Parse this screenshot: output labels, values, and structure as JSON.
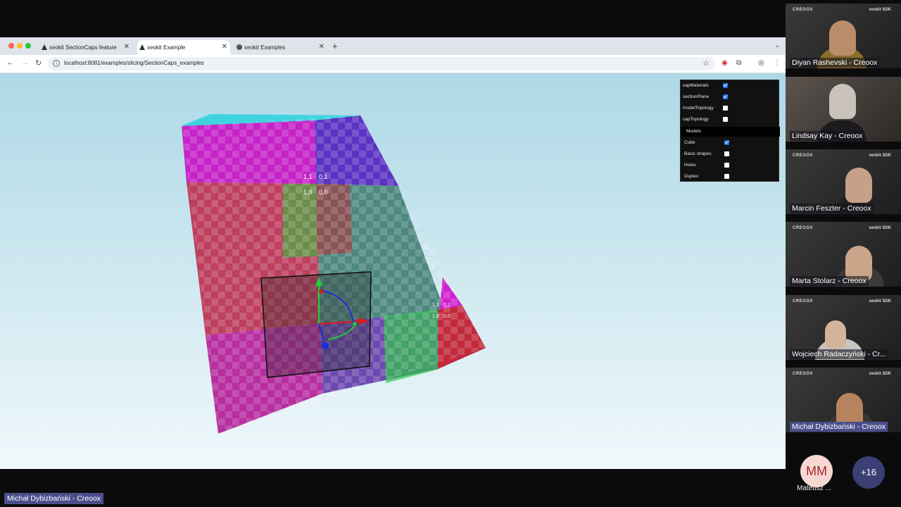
{
  "browser": {
    "tabs": [
      {
        "title": "xeokit SectionCaps feature",
        "active": false
      },
      {
        "title": "xeokit Example",
        "active": true
      },
      {
        "title": "xeokit Examples",
        "active": false
      }
    ],
    "url": "localhost:8081/examples/slicing/SectionCaps_examples"
  },
  "panel": {
    "options": [
      {
        "label": "capMaterials",
        "checked": true
      },
      {
        "label": "sectionPlane",
        "checked": true
      },
      {
        "label": "modelTopology",
        "checked": false
      },
      {
        "label": "capTopology",
        "checked": false
      }
    ],
    "folder_label": "Models",
    "models": [
      {
        "label": "Cube",
        "checked": true
      },
      {
        "label": "Basic shapes",
        "checked": false
      },
      {
        "label": "Holes",
        "checked": false
      },
      {
        "label": "Duplex",
        "checked": false
      }
    ]
  },
  "scene": {
    "uv_labels_top": [
      "1,1",
      "0,1",
      "1,0",
      "0,0"
    ],
    "uv_labels_side": [
      "1,1",
      "0,1",
      "1,0",
      "0,0"
    ],
    "colors": {
      "magenta": "#d21fd0",
      "blue": "#4a38c8",
      "red": "#c72b45",
      "green": "#22c53c"
    }
  },
  "participants": [
    {
      "name": "Diyan Rashevski - Creoox"
    },
    {
      "name": "Lindsay Kay - Creoox"
    },
    {
      "name": "Marcin Feszter - Creoox"
    },
    {
      "name": "Marta Stolarz - Creoox"
    },
    {
      "name": "Wojciech Radaczyński - Cr..."
    },
    {
      "name": "Michał Dybizbański - Creoox"
    }
  ],
  "tile_logos": {
    "left": "CREOOX",
    "right": "xeokit SDK"
  },
  "extra_participant": {
    "initials": "MM",
    "name": "Mateusz ..."
  },
  "more_count": "+16",
  "active_speaker": "Michał Dybizbański - Creoox"
}
